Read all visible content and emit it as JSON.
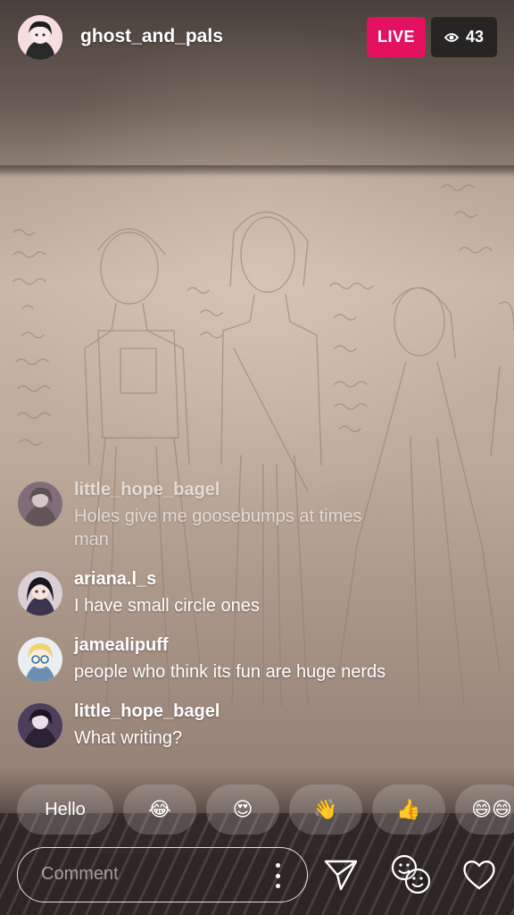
{
  "host": {
    "username": "ghost_and_pals",
    "avatar_icon": "user-avatar"
  },
  "live_badge": "LIVE",
  "viewers": {
    "icon": "eye-icon",
    "count": "43"
  },
  "comments": [
    {
      "username": "little_hope_bagel",
      "text": "Holes give me goosebumps at times man",
      "faded": true
    },
    {
      "username": "ariana.l_s",
      "text": "I have small circle ones"
    },
    {
      "username": "jamealipuff",
      "text": "people who think its fun are huge nerds"
    },
    {
      "username": "little_hope_bagel",
      "text": "What writing?"
    }
  ],
  "quick_replies": [
    {
      "type": "text",
      "label": "Hello"
    },
    {
      "type": "emoji",
      "label": "😂",
      "icon": "tears-of-joy-emoji"
    },
    {
      "type": "emoji",
      "label": "😍",
      "icon": "heart-eyes-emoji"
    },
    {
      "type": "emoji",
      "label": "👋",
      "icon": "waving-hand-emoji"
    },
    {
      "type": "emoji",
      "label": "👍",
      "icon": "thumbs-up-emoji"
    },
    {
      "type": "emoji",
      "label": "😄😄",
      "icon": "grinning-emoji"
    }
  ],
  "comment_field": {
    "placeholder": "Comment",
    "options_icon": "more-options-icon"
  },
  "actions": {
    "send_icon": "send-icon",
    "face_filter_icon": "faces-icon",
    "like_icon": "heart-icon"
  }
}
